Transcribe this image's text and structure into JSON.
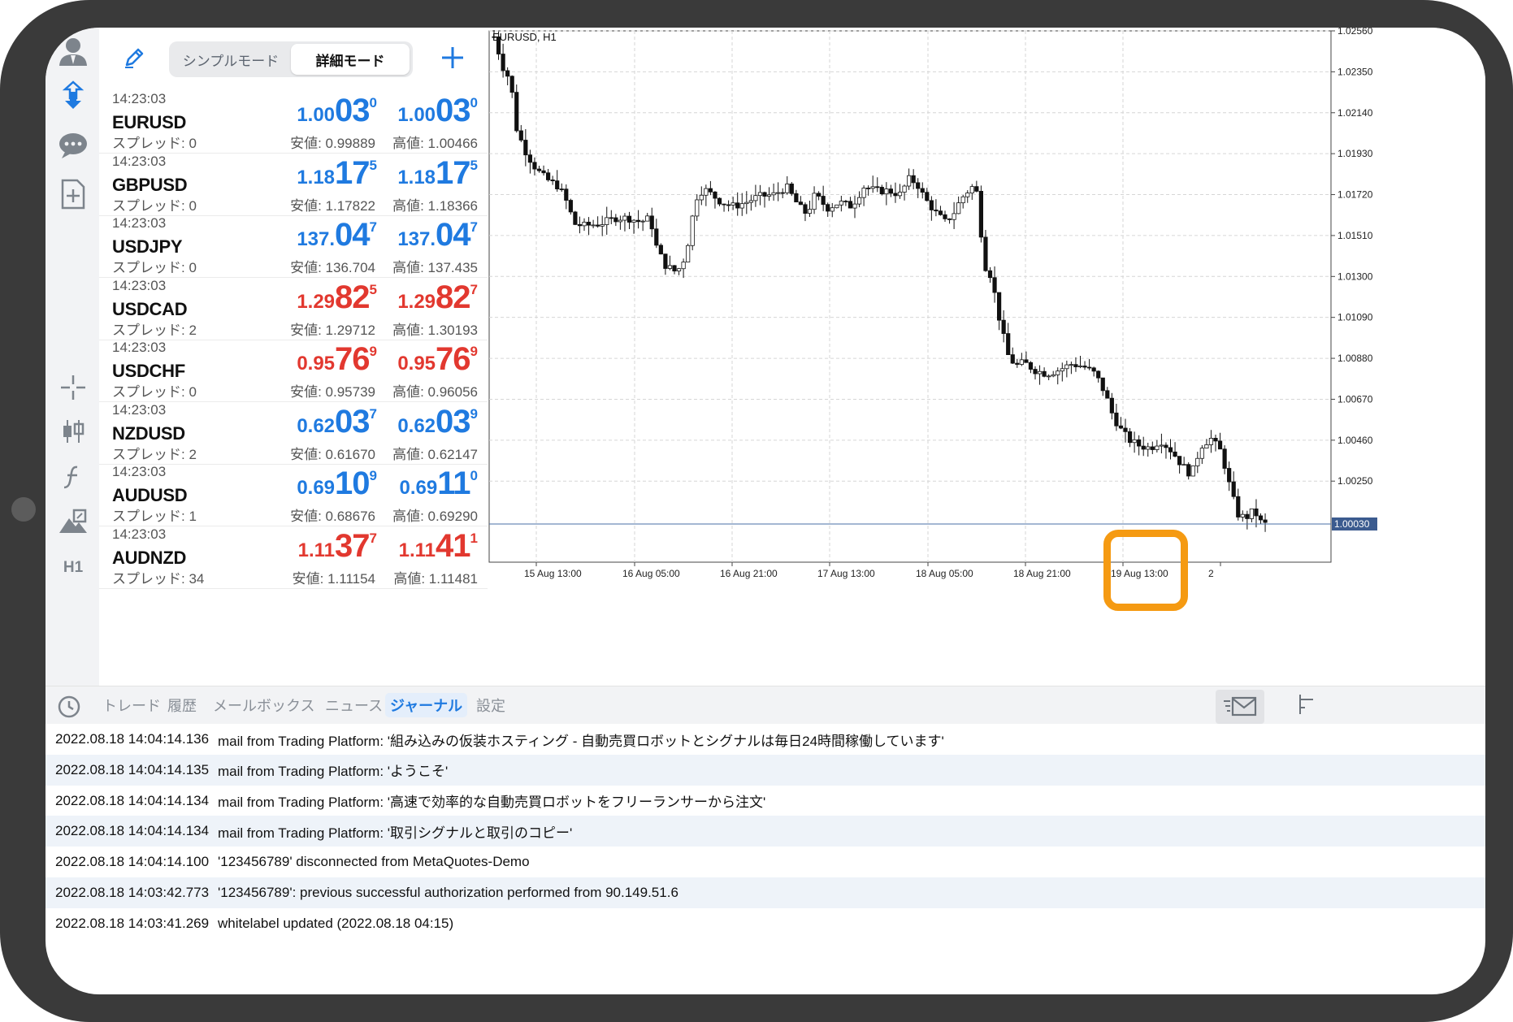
{
  "sidebar": {
    "items": [
      "account-icon",
      "quotes-icon",
      "chat-icon",
      "new-document-icon",
      "crosshair-icon",
      "candlestick-icon",
      "indicators-icon",
      "objects-icon"
    ],
    "timeframe": "H1"
  },
  "quotes": {
    "mode_simple": "シンプルモード",
    "mode_advanced": "詳細モード",
    "rows": [
      {
        "time": "14:23:03",
        "symbol": "EURUSD",
        "spread": "スプレッド: 0",
        "bid": {
          "small": "1.00",
          "big": "03",
          "sup": "0"
        },
        "ask": {
          "small": "1.00",
          "big": "03",
          "sup": "0"
        },
        "low": "安値: 0.99889",
        "high": "高値: 1.00466",
        "color": "#1f7ae0"
      },
      {
        "time": "14:23:03",
        "symbol": "GBPUSD",
        "spread": "スプレッド: 0",
        "bid": {
          "small": "1.18",
          "big": "17",
          "sup": "5"
        },
        "ask": {
          "small": "1.18",
          "big": "17",
          "sup": "5"
        },
        "low": "安値: 1.17822",
        "high": "高値: 1.18366",
        "color": "#1f7ae0"
      },
      {
        "time": "14:23:03",
        "symbol": "USDJPY",
        "spread": "スプレッド: 0",
        "bid": {
          "small": "137.",
          "big": "04",
          "sup": "7"
        },
        "ask": {
          "small": "137.",
          "big": "04",
          "sup": "7"
        },
        "low": "安値: 136.704",
        "high": "高値: 137.435",
        "color": "#1f7ae0"
      },
      {
        "time": "14:23:03",
        "symbol": "USDCAD",
        "spread": "スプレッド: 2",
        "bid": {
          "small": "1.29",
          "big": "82",
          "sup": "5"
        },
        "ask": {
          "small": "1.29",
          "big": "82",
          "sup": "7"
        },
        "low": "安値: 1.29712",
        "high": "高値: 1.30193",
        "color": "#e2382f"
      },
      {
        "time": "14:23:03",
        "symbol": "USDCHF",
        "spread": "スプレッド: 0",
        "bid": {
          "small": "0.95",
          "big": "76",
          "sup": "9"
        },
        "ask": {
          "small": "0.95",
          "big": "76",
          "sup": "9"
        },
        "low": "安値: 0.95739",
        "high": "高値: 0.96056",
        "color": "#e2382f"
      },
      {
        "time": "14:23:03",
        "symbol": "NZDUSD",
        "spread": "スプレッド: 2",
        "bid": {
          "small": "0.62",
          "big": "03",
          "sup": "7"
        },
        "ask": {
          "small": "0.62",
          "big": "03",
          "sup": "9"
        },
        "low": "安値: 0.61670",
        "high": "高値: 0.62147",
        "color": "#1f7ae0"
      },
      {
        "time": "14:23:03",
        "symbol": "AUDUSD",
        "spread": "スプレッド: 1",
        "bid": {
          "small": "0.69",
          "big": "10",
          "sup": "9"
        },
        "ask": {
          "small": "0.69",
          "big": "11",
          "sup": "0"
        },
        "low": "安値: 0.68676",
        "high": "高値: 0.69290",
        "color": "#1f7ae0"
      },
      {
        "time": "14:23:03",
        "symbol": "AUDNZD",
        "spread": "スプレッド: 34",
        "bid": {
          "small": "1.11",
          "big": "37",
          "sup": "7"
        },
        "ask": {
          "small": "1.11",
          "big": "41",
          "sup": "1"
        },
        "low": "安値: 1.11154",
        "high": "高値: 1.11481",
        "color": "#e2382f"
      }
    ]
  },
  "chart": {
    "title": "EURUSD, H1",
    "current_price": "1.00030",
    "y_labels": [
      "1.02560",
      "1.02350",
      "1.02140",
      "1.01930",
      "1.01720",
      "1.01510",
      "1.01300",
      "1.01090",
      "1.00880",
      "1.00670",
      "1.00460",
      "1.00250"
    ],
    "x_labels": [
      "15 Aug 13:00",
      "16 Aug 05:00",
      "16 Aug 21:00",
      "17 Aug 13:00",
      "18 Aug 05:00",
      "18 Aug 21:00",
      "19 Aug 13:00",
      "2"
    ]
  },
  "tabs": {
    "items": [
      "トレード",
      "履歴",
      "メールボックス",
      "ニュース",
      "ジャーナル",
      "設定"
    ],
    "active_index": 4
  },
  "journal": [
    {
      "time": "2022.08.18 14:04:14.136",
      "msg": "mail from Trading Platform: '組み込みの仮装ホスティング - 自動売買ロボットとシグナルは毎日24時間稼働しています'"
    },
    {
      "time": "2022.08.18 14:04:14.135",
      "msg": "mail from Trading Platform: 'ようこそ'"
    },
    {
      "time": "2022.08.18 14:04:14.134",
      "msg": "mail from Trading Platform: '高速で効率的な自動売買ロボットをフリーランサーから注文'"
    },
    {
      "time": "2022.08.18 14:04:14.134",
      "msg": "mail from Trading Platform: '取引シグナルと取引のコピー'"
    },
    {
      "time": "2022.08.18 14:04:14.100",
      "msg": "'123456789' disconnected from MetaQuotes-Demo"
    },
    {
      "time": "2022.08.18 14:03:42.773",
      "msg": "'123456789': previous successful authorization performed from 90.149.51.6"
    },
    {
      "time": "2022.08.18 14:03:41.269",
      "msg": "whitelabel updated (2022.08.18 04:15)"
    }
  ],
  "colors": {
    "accent": "#1f7ae0",
    "down": "#e2382f",
    "highlight": "#f59a12"
  }
}
